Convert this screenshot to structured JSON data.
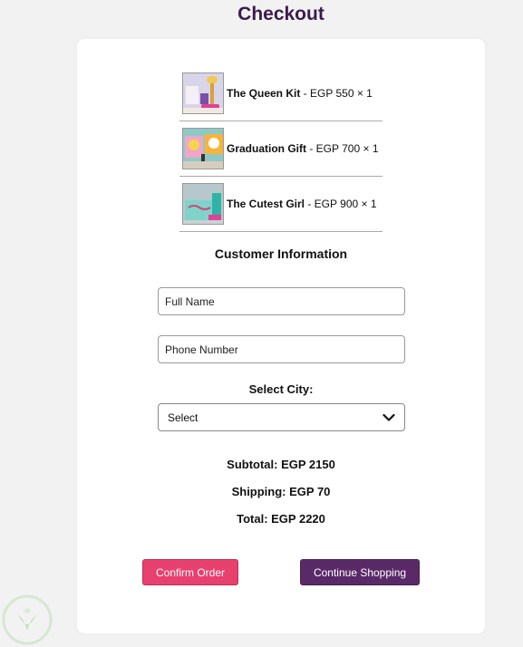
{
  "page": {
    "title": "Checkout"
  },
  "cart": {
    "items": [
      {
        "name": "The Queen Kit",
        "details": " - EGP 550 × 1",
        "image": "queen-kit-thumbnail"
      },
      {
        "name": "Graduation Gift",
        "details": " - EGP 700 × 1",
        "image": "graduation-gift-thumbnail"
      },
      {
        "name": "The Cutest Girl",
        "details": " - EGP 900 × 1",
        "image": "cutest-girl-thumbnail"
      }
    ]
  },
  "customer": {
    "title": "Customer Information",
    "full_name_placeholder": "Full Name",
    "phone_placeholder": "Phone Number",
    "city_label": "Select City:",
    "city_selected": "Select"
  },
  "summary": {
    "subtotal": "Subtotal: EGP 2150",
    "shipping": "Shipping: EGP 70",
    "total": "Total: EGP 2220"
  },
  "actions": {
    "confirm_label": "Confirm Order",
    "continue_label": "Continue Shopping"
  },
  "colors": {
    "title": "#3b1c4d",
    "confirm": "#e8406f",
    "continue": "#5a2a68"
  },
  "icons": {
    "select_chevron": "chevron-down-icon",
    "watermark": "watermark-logo-icon"
  }
}
